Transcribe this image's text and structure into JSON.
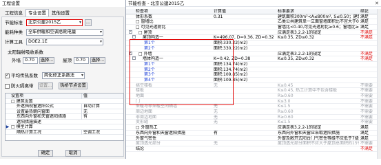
{
  "left_dialog": {
    "title": "工程设置",
    "tabs": [
      "工程信息",
      "专业设置",
      "其他设置"
    ],
    "active_tab": 1,
    "standard_label": "节能标准",
    "standard_value": "北京公建2015乙",
    "energy_type_label": "能耗种类",
    "energy_type_value": "全年供暖和空调总耗电量",
    "calc_tool_label": "计算工具",
    "calc_tool_value": "DOE2.1E",
    "solar_label": "太阳辐射吸收系数",
    "outer_wall_label": "外墙",
    "outer_wall_value": "0.70",
    "roof_label": "屋顶",
    "roof_value": "0.70",
    "select_label": "选择...",
    "avg_heat_label": "平均传热系数",
    "avg_heat_value": "简化修正系数法",
    "fire_label": "防火隔离带",
    "setting_label": "设置...",
    "thermal_bridge_label": "热桥节点设置",
    "grid_head": [
      "设置项",
      "值"
    ],
    "grid_rows": [
      {
        "text": "□ 建筑设置",
        "value": "",
        "indent": 0,
        "mark": ""
      },
      {
        "text": "外遮挡视窗遮阳公式",
        "value": "自动计算",
        "indent": 2,
        "mark": ""
      },
      {
        "text": "设置最热朝向窗面",
        "value": "无",
        "indent": 2,
        "mark": ""
      },
      {
        "text": "东西向外窗和天窗遮阳措施",
        "value": "有",
        "indent": 2,
        "mark": ""
      },
      {
        "text": "遮阳措施描述",
        "value": "",
        "indent": 2,
        "mark": ""
      },
      {
        "text": "□ 模型计算",
        "value": "",
        "indent": 0,
        "mark": "▶"
      },
      {
        "text": "隔热计算工况",
        "value": "空调工况",
        "indent": 2,
        "mark": ""
      }
    ],
    "confirm_label": "确定",
    "cancel_label": "取消"
  },
  "right_window": {
    "title": "节能检查 - 北京公建2015乙",
    "headers": [
      "检查项",
      "计算值",
      "标准要求",
      "结论"
    ],
    "rows": [
      {
        "item": "体形系数",
        "calc": "0.31",
        "req": "建筑面积300m²<A≤800m², S≤0.50；建筑面积A>800m², S≤0.40",
        "result": "满足",
        "lvl": 0,
        "style": "",
        "res": "ok",
        "exp": ""
      },
      {
        "item": "□ 窗墙比",
        "calc": "",
        "req": "乙类公共建筑单一立面窗墙面积比不宜大于0.70",
        "result": "满足",
        "lvl": 0,
        "style": "",
        "res": "ok",
        "exp": ""
      },
      {
        "item": "□ 可见光透射比",
        "calc": "",
        "req": "窗墙比<0.40,可见光透射比≥0.6；窗墙比≥0.40,可见光透射比≥0.4",
        "result": "满足",
        "lvl": 0,
        "style": "",
        "res": "ok",
        "exp": ""
      },
      {
        "item": "□ 屋顶",
        "calc": "",
        "req": "应满足表3.2.2-1的规定",
        "result": "不满足",
        "lvl": 0,
        "style": "",
        "res": "fail",
        "exp": "-"
      },
      {
        "item": "屋顶构造一",
        "calc": "K=496.07, D=0.36, ZD=0.32",
        "req": "K≤0.35, ZD≤0.32",
        "result": "不满足",
        "lvl": 1,
        "style": "",
        "res": "fail",
        "exp": "-"
      },
      {
        "item": "第1个",
        "calc": "面积:330.22(m2)",
        "req": "",
        "result": "",
        "lvl": 2,
        "style": "blue",
        "res": "ok",
        "exp": ""
      },
      {
        "item": "第2个",
        "calc": "面积:330.22(m2)",
        "req": "",
        "result": "",
        "lvl": 2,
        "style": "blue",
        "res": "ok",
        "exp": ""
      },
      {
        "item": "□ 外墙",
        "calc": "",
        "req": "应满足表3.2.2-1的规定",
        "result": "不满足",
        "lvl": 0,
        "style": "",
        "res": "fail",
        "exp": "-"
      },
      {
        "item": "墙体构造一",
        "calc": "K=0.42, ZD=0.38",
        "req": "K≤0.35, ZD≤0.32",
        "result": "不满足",
        "lvl": 1,
        "style": "",
        "res": "fail",
        "exp": "-"
      },
      {
        "item": "第1个",
        "calc": "面积:134.74(m2)",
        "req": "",
        "result": "",
        "lvl": 2,
        "style": "blue",
        "res": "ok",
        "exp": ""
      },
      {
        "item": "第2个",
        "calc": "面积:134.74(m2)",
        "req": "",
        "result": "",
        "lvl": 2,
        "style": "blue",
        "res": "ok",
        "exp": ""
      },
      {
        "item": "第3个",
        "calc": "面积:109.85(m2)",
        "req": "",
        "result": "",
        "lvl": 2,
        "style": "blue",
        "res": "ok",
        "exp": ""
      },
      {
        "item": "第4个",
        "calc": "面积:109.85(m2)",
        "req": "",
        "result": "",
        "lvl": 2,
        "style": "blue",
        "res": "ok",
        "exp": ""
      },
      {
        "item": "挑空楼板",
        "calc": "无",
        "req": "K≤0.45",
        "result": "不需要",
        "lvl": 0,
        "style": "dim",
        "res": "ok",
        "exp": ""
      },
      {
        "item": "楼板",
        "calc": "",
        "req": "K≤0.45, 热工计算中不包含楼板",
        "result": "不需要",
        "lvl": 0,
        "style": "dim",
        "res": "ok",
        "exp": ""
      },
      {
        "item": "地面",
        "calc": "",
        "req": "R≥0.60",
        "result": "不需要",
        "lvl": 0,
        "style": "dim",
        "res": "ok",
        "exp": ""
      },
      {
        "item": "门",
        "calc": "",
        "req": "K≤3.0",
        "result": "不需要",
        "lvl": 0,
        "style": "dim",
        "res": "ok",
        "exp": ""
      },
      {
        "item": "采暖与非采暖空间隔墙",
        "calc": "无",
        "req": "K≤1.5",
        "result": "不需要",
        "lvl": 0,
        "style": "dim",
        "res": "ok",
        "exp": ""
      },
      {
        "item": "周边地面",
        "calc": "无",
        "req": "R≥0.60",
        "result": "不需要",
        "lvl": 0,
        "style": "dim",
        "res": "ok",
        "exp": ""
      },
      {
        "item": "非周边地面",
        "calc": "无",
        "req": "R≥0.60",
        "result": "不需要",
        "lvl": 0,
        "style": "dim",
        "res": "ok",
        "exp": ""
      },
      {
        "item": "变形缝",
        "calc": "无",
        "req": "K≤1.5",
        "result": "不需要",
        "lvl": 0,
        "style": "dim",
        "res": "ok",
        "exp": ""
      },
      {
        "item": "□ 外窗热工",
        "calc": "",
        "req": "应满足表3.2.2-1的规定",
        "result": "满足",
        "lvl": 0,
        "style": "",
        "res": "ok",
        "exp": ""
      },
      {
        "item": "东西向外窗和天窗遮阳措施",
        "calc": "有",
        "req": "东西向外窗和天窗应采取遮阳措施",
        "result": "满足",
        "lvl": 0,
        "style": "",
        "res": "ok",
        "exp": ""
      },
      {
        "item": "外窗气密性",
        "calc": "",
        "req": "外窗及敞开式阳台门气密性等级不应低于7级",
        "result": "满足",
        "lvl": 0,
        "style": "",
        "res": "ok",
        "exp": ""
      },
      {
        "item": "屋顶透光部分",
        "calc": "无",
        "req": "屋顶透光部分面积不应大于屋顶总面积的15%",
        "result": "不需要",
        "lvl": 0,
        "style": "dim",
        "res": "ok",
        "exp": ""
      },
      {
        "item": "结论",
        "calc": "",
        "req": "",
        "result": "不满足",
        "lvl": 0,
        "style": "",
        "res": "fail",
        "exp": ""
      }
    ]
  },
  "colors": {
    "fail": "#e00000",
    "link": "#1b3fd8",
    "highlight": "#e00000"
  }
}
